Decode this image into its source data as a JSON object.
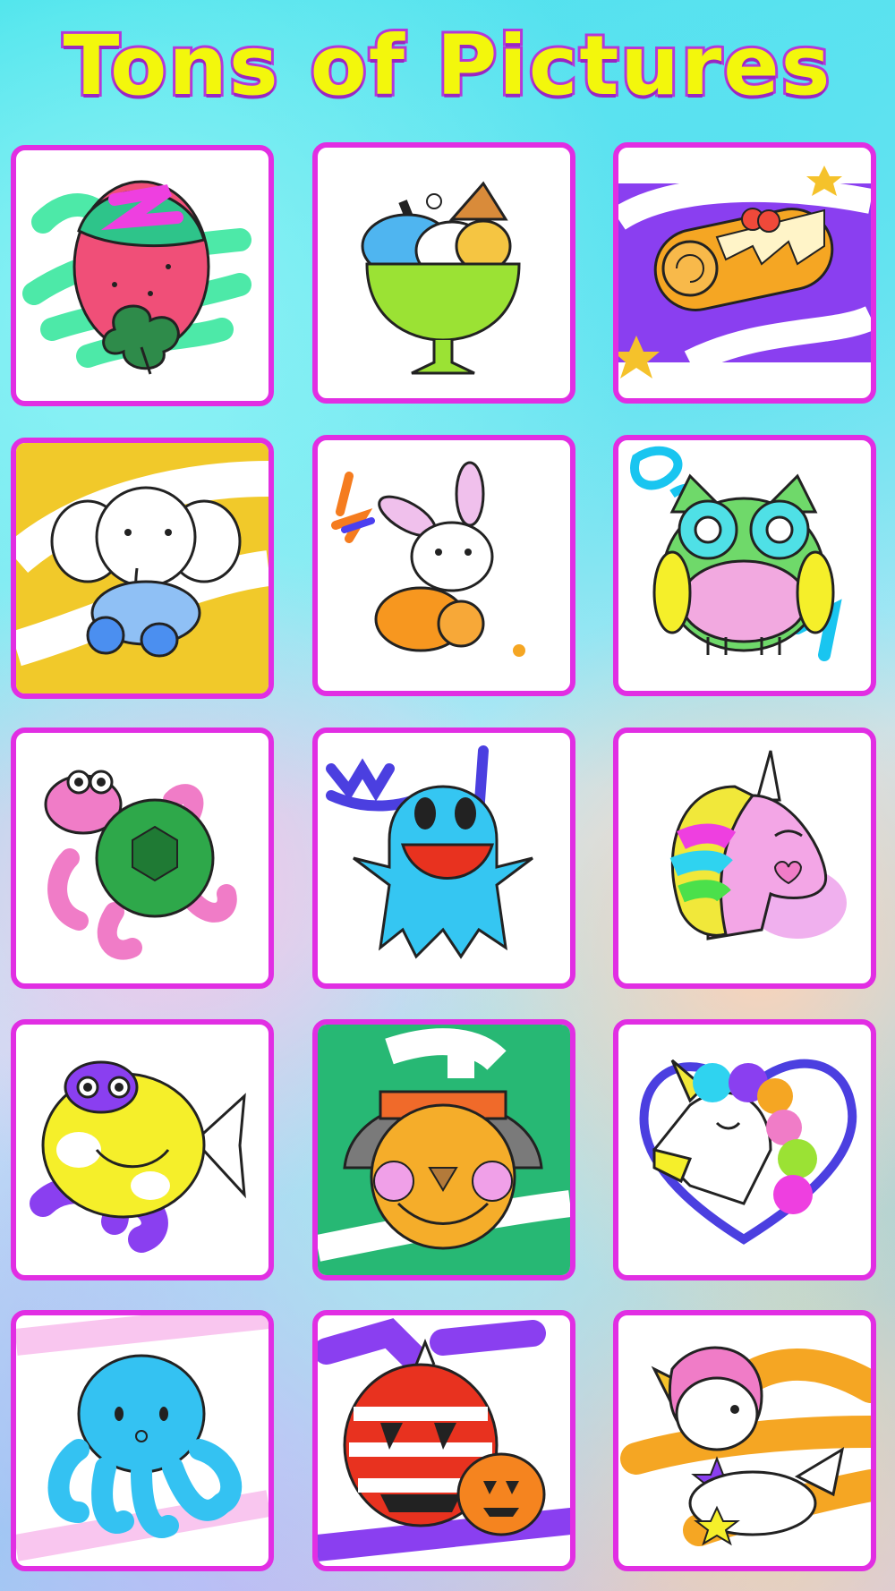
{
  "header": {
    "title": "Tons of Pictures"
  },
  "colors": {
    "title_fill": "#f3f70c",
    "title_stroke": "#b437d9",
    "tile_border": "#e12ee3"
  },
  "pictures": [
    {
      "icon": "strawberry-icon"
    },
    {
      "icon": "ice-cream-sundae-icon"
    },
    {
      "icon": "swiss-roll-cake-icon"
    },
    {
      "icon": "elephant-icon"
    },
    {
      "icon": "bunny-icon"
    },
    {
      "icon": "owl-icon"
    },
    {
      "icon": "turtle-icon"
    },
    {
      "icon": "ghost-icon"
    },
    {
      "icon": "unicorn-head-icon"
    },
    {
      "icon": "fish-icon"
    },
    {
      "icon": "scarecrow-icon"
    },
    {
      "icon": "unicorn-heart-icon"
    },
    {
      "icon": "octopus-icon"
    },
    {
      "icon": "pumpkins-icon"
    },
    {
      "icon": "pegasus-unicorn-icon"
    }
  ]
}
